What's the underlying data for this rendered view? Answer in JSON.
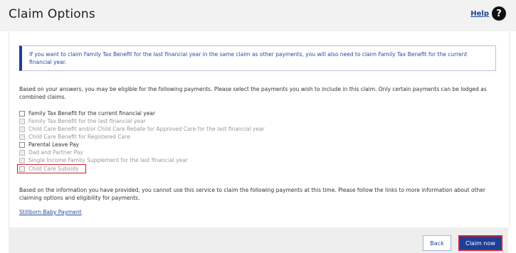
{
  "header": {
    "title": "Claim Options",
    "help_label": "Help",
    "help_icon_glyph": "?"
  },
  "notice": {
    "text": "If you want to claim Family Tax Benefit for the last financial year in the same claim as other payments, you will also need to claim Family Tax Benefit for the current financial year."
  },
  "intro": {
    "text": "Based on your answers, you may be eligible for the following payments. Please select the payments you wish to include in this claim. Only certain payments can be lodged as combined claims."
  },
  "options": [
    {
      "label": "Family Tax Benefit for the current financial year",
      "enabled": true,
      "checked": false
    },
    {
      "label": "Family Tax Benefit for the last financial year",
      "enabled": false,
      "checked": false
    },
    {
      "label": "Child Care Benefit and/or Child Care Rebate for Approved Care for the last financial year",
      "enabled": false,
      "checked": false
    },
    {
      "label": "Child Care Benefit for Registered Care",
      "enabled": false,
      "checked": false
    },
    {
      "label": "Parental Leave Pay",
      "enabled": true,
      "checked": false
    },
    {
      "label": "Dad and Partner Pay",
      "enabled": false,
      "checked": false
    },
    {
      "label": "Single Income Family Supplement for the last financial year",
      "enabled": false,
      "checked": false
    },
    {
      "label": "Child Care Subsidy",
      "enabled": false,
      "checked": true
    }
  ],
  "info": {
    "text": "Based on the information you have provided, you cannot use this service to claim the following payments at this time. Please follow the links to more information about other claiming options and eligibility for payments."
  },
  "links": {
    "stillborn": "Stillborn Baby Payment"
  },
  "footer": {
    "back_label": "Back",
    "claim_label": "Claim now"
  },
  "colors": {
    "brand_blue": "#1d3f96",
    "highlight_red": "#cc1f2f"
  }
}
